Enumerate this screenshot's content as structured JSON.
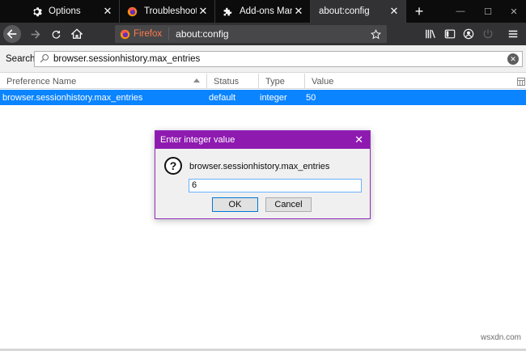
{
  "tabs": [
    {
      "label": "Options",
      "icon": "gear-icon",
      "active": false
    },
    {
      "label": "Troubleshooting I",
      "icon": "firefox-icon",
      "active": false
    },
    {
      "label": "Add-ons Manager",
      "icon": "puzzle-icon",
      "active": false
    },
    {
      "label": "about:config",
      "icon": "",
      "active": true
    }
  ],
  "tab_close_glyph": "✕",
  "new_tab_glyph": "+",
  "window_controls": {
    "minimize": "—",
    "maximize": "☐",
    "close": "✕"
  },
  "urlbar": {
    "identity": "Firefox",
    "url": "about:config"
  },
  "search": {
    "label": "Search:",
    "value": "browser.sessionhistory.max_entries"
  },
  "table": {
    "columns": [
      "Preference Name",
      "Status",
      "Type",
      "Value"
    ],
    "rows": [
      {
        "name": "browser.sessionhistory.max_entries",
        "status": "default",
        "type": "integer",
        "value": "50"
      }
    ]
  },
  "dialog": {
    "title": "Enter integer value",
    "message": "browser.sessionhistory.max_entries",
    "input_value": "6",
    "ok_label": "OK",
    "cancel_label": "Cancel",
    "close_glyph": "✕"
  },
  "watermark": "wsxdn.com",
  "colors": {
    "accent": "#0a84ff",
    "dialog_title": "#8f1ab0",
    "toolbar": "#323234",
    "tabstrip": "#0c0c0d"
  }
}
